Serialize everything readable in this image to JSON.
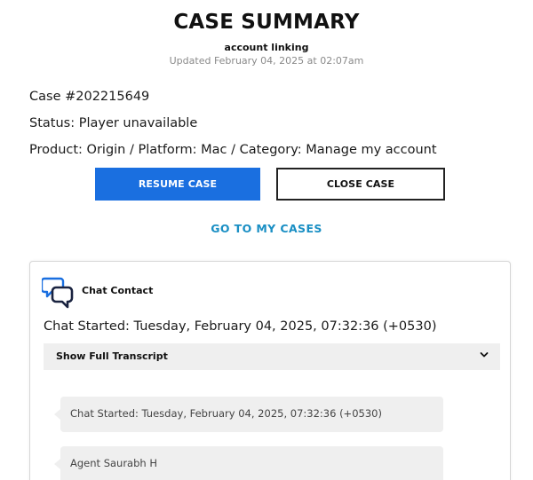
{
  "header": {
    "title": "CASE SUMMARY",
    "subtitle": "account linking",
    "updated": "Updated February 04, 2025 at 02:07am"
  },
  "case": {
    "number": "Case #202215649",
    "status": "Status: Player unavailable",
    "details": "Product: Origin / Platform: Mac / Category: Manage my account"
  },
  "actions": {
    "resume_label": "RESUME CASE",
    "close_label": "CLOSE CASE",
    "my_cases_label": "GO TO MY CASES"
  },
  "chat": {
    "heading": "Chat Contact",
    "started": "Chat Started: Tuesday, February 04, 2025, 07:32:36 (+0530)",
    "transcript_toggle": "Show Full Transcript",
    "messages": [
      {
        "text": "Chat Started: Tuesday, February 04, 2025, 07:32:36 (+0530)"
      },
      {
        "text": "Agent Saurabh H"
      }
    ]
  },
  "colors": {
    "primary_button": "#1a6fe0",
    "link": "#1a8fc4",
    "icon_accent": "#1a6fe0",
    "icon_dark": "#1a2340"
  },
  "icons": {
    "chat": "chat-bubbles-icon",
    "expand": "chevron-down-icon"
  }
}
